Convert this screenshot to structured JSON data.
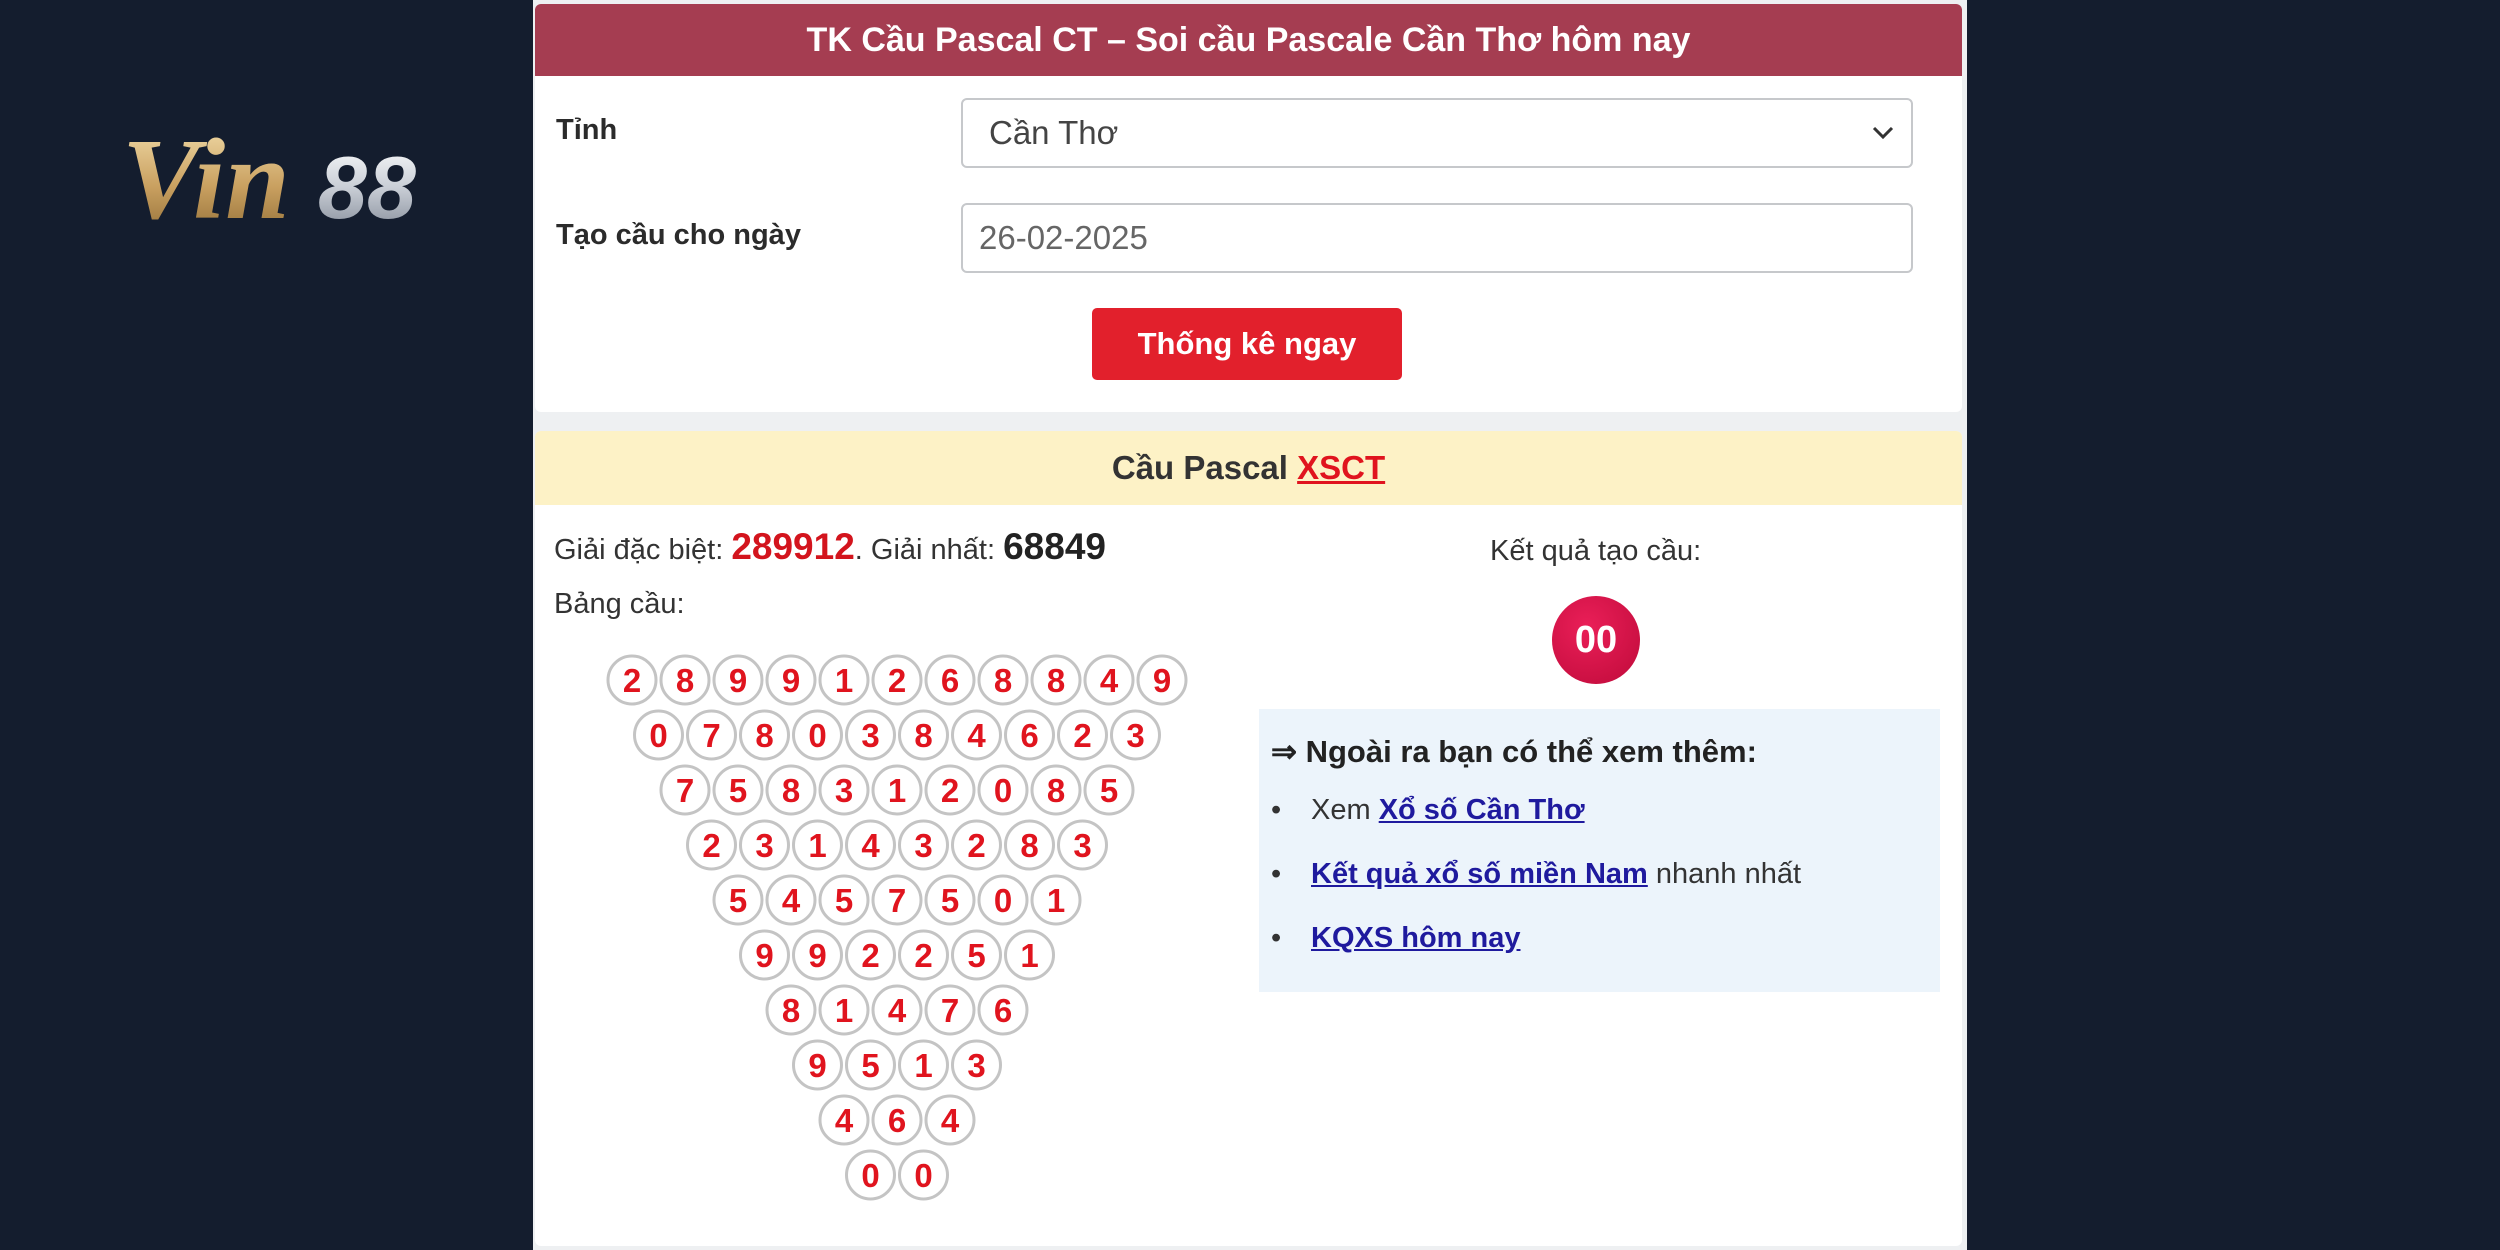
{
  "logo": {
    "text": "Vin88",
    "part1": "Vin",
    "part2": "88"
  },
  "form": {
    "title": "TK Cầu Pascal CT – Soi cầu Pascale Cần Thơ hôm nay",
    "province_label": "Tỉnh",
    "province_value": "Cần Thơ",
    "date_label": "Tạo cầu cho ngày",
    "date_value": "26-02-2025",
    "submit_label": "Thống kê ngay"
  },
  "result": {
    "header_prefix": "Cầu Pascal",
    "header_link": "XSCT",
    "special_label": "Giải đặc biệt:",
    "special_value": "289912",
    "first_label": ". Giải nhất:",
    "first_value": "68849",
    "table_label": "Bảng cầu:",
    "rows": [
      "28991268849",
      "0780384623",
      "758312085",
      "23143283",
      "5457501",
      "992251",
      "81476",
      "9513",
      "464",
      "00"
    ],
    "result_label": "Kết quả tạo cầu:",
    "result_value": "00"
  },
  "more": {
    "title": "⇒ Ngoài ra bạn có thể xem thêm:",
    "bullet": "•",
    "item1_prefix": "Xem ",
    "item1_link": "Xổ số Cần Thơ",
    "item2_link": "Kết quả xổ số miền Nam",
    "item2_suffix": " nhanh nhất",
    "item3_link": "KQXS hôm nay"
  },
  "colors": {
    "page_bg": "#141d2e",
    "form_header": "#a53d51",
    "button": "#e2202c",
    "result_header": "#fdf2c6",
    "digit": "#e0141e",
    "ball": "#d41049",
    "link": "#1f1a9e"
  }
}
